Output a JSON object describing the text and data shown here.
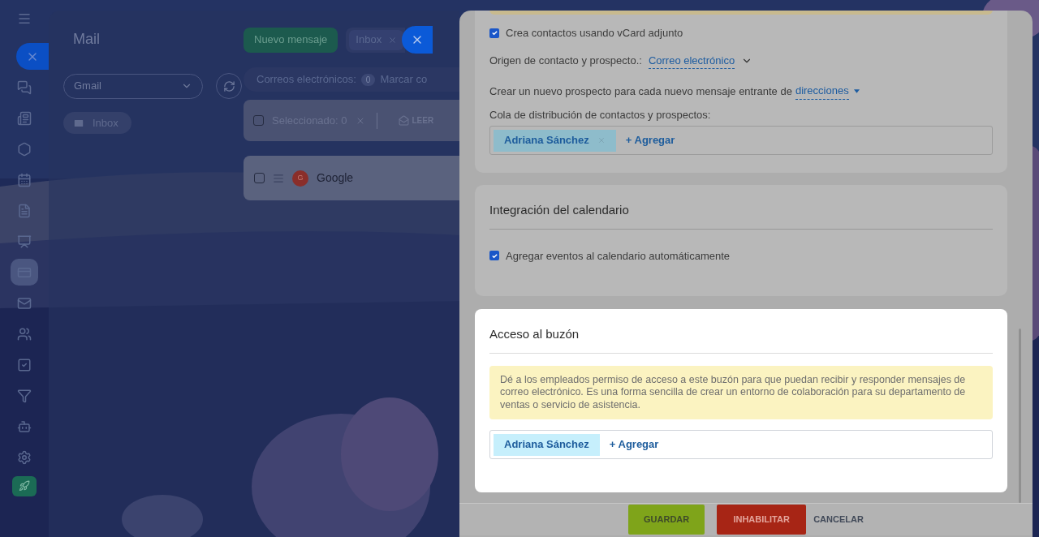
{
  "sidebar": {
    "items": [
      {
        "selected": false
      },
      {
        "selected": false
      },
      {
        "selected": false
      },
      {
        "selected": false
      },
      {
        "selected": false
      },
      {
        "selected": false
      },
      {
        "selected": true
      },
      {
        "selected": false
      },
      {
        "selected": false
      },
      {
        "selected": false
      },
      {
        "selected": false
      },
      {
        "selected": false
      },
      {
        "selected": false
      }
    ]
  },
  "mail": {
    "title": "Mail",
    "mailbox_select": {
      "value": "Gmail"
    },
    "folders": [
      {
        "label": "Inbox",
        "selected": true
      }
    ],
    "new_message_button": "Nuevo mensaje",
    "tabs": [
      {
        "label": "Inbox"
      }
    ],
    "counter_bar": {
      "label": "Correos electrónicos:",
      "count": "0",
      "action": "Marcar co"
    },
    "toolbar": {
      "checked": false,
      "selected_label": "Seleccionado: 0",
      "read_button": "LEER"
    },
    "messages": [
      {
        "avatar": "G",
        "sender": "Google",
        "checked": false
      }
    ]
  },
  "settings": {
    "top_section": {
      "checkbox": {
        "label": "Crea contactos usando vCard adjunto",
        "checked": true
      },
      "source": {
        "label": "Origen de contacto y prospecto.:",
        "value": "Correo electrónico"
      },
      "new_lead": {
        "label": "Crear un nuevo prospecto para cada nuevo mensaje entrante de",
        "value": "direcciones"
      },
      "queue": {
        "label": "Cola de distribución de contactos y prospectos:",
        "chips": [
          {
            "label": "Adriana Sánchez",
            "removable": true
          }
        ],
        "add": "+ Agregar"
      }
    },
    "calendar_section": {
      "title": "Integración del calendario",
      "checkbox": {
        "label": "Agregar eventos al calendario automáticamente",
        "checked": true
      }
    },
    "access_section": {
      "title": "Acceso al buzón",
      "notice": "Dé a los empleados permiso de acceso a este buzón para que puedan recibir y responder mensajes de correo electrónico. Es una forma sencilla de crear un entorno de colaboración para su departamento de ventas o servicio de asistencia.",
      "chips": [
        {
          "label": "Adriana Sánchez",
          "removable": false
        }
      ],
      "add": "+ Agregar"
    }
  },
  "footer": {
    "save": "GUARDAR",
    "disable": "INHABILITAR",
    "cancel": "CANCELAR"
  }
}
